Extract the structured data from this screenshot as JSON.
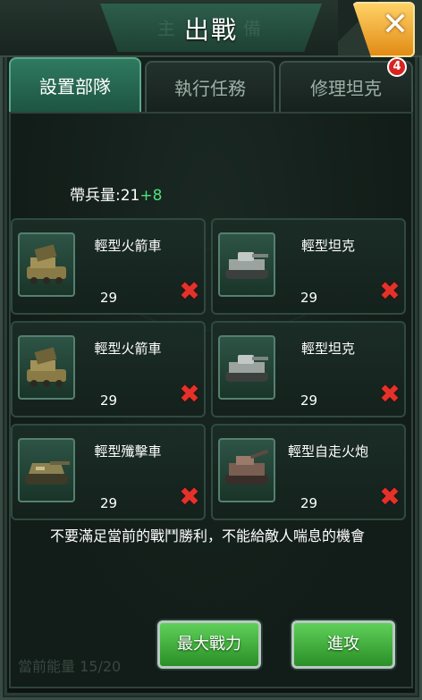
{
  "window": {
    "title": "出戰",
    "title_ghost_left": "主",
    "title_ghost_right": "備"
  },
  "tabs": [
    {
      "label": "設置部隊",
      "active": true
    },
    {
      "label": "執行任務",
      "active": false
    },
    {
      "label": "修理坦克",
      "active": false
    }
  ],
  "tab_badge": "4",
  "capacity": {
    "label": "帶兵量:21",
    "bonus": "+8"
  },
  "units": [
    {
      "name": "輕型火箭車",
      "count": "29",
      "icon": "rocket-truck-icon"
    },
    {
      "name": "輕型坦克",
      "count": "29",
      "icon": "light-tank-icon"
    },
    {
      "name": "輕型火箭車",
      "count": "29",
      "icon": "rocket-truck-icon"
    },
    {
      "name": "輕型坦克",
      "count": "29",
      "icon": "light-tank-icon"
    },
    {
      "name": "輕型殲擊車",
      "count": "29",
      "icon": "tank-destroyer-icon"
    },
    {
      "name": "輕型自走火炮",
      "count": "29",
      "icon": "self-propelled-gun-icon"
    }
  ],
  "quote": "不要滿足當前的戰鬥勝利，不能給敵人喘息的機會",
  "footer_ghost": "當前能量 15/20",
  "buttons": {
    "max_power": "最大戰力",
    "attack": "進攻"
  },
  "colors": {
    "accent_green": "#2f7a60",
    "bonus_green": "#4fe07a",
    "remove_red": "#e4322b",
    "close_gold": "#e28b15"
  }
}
